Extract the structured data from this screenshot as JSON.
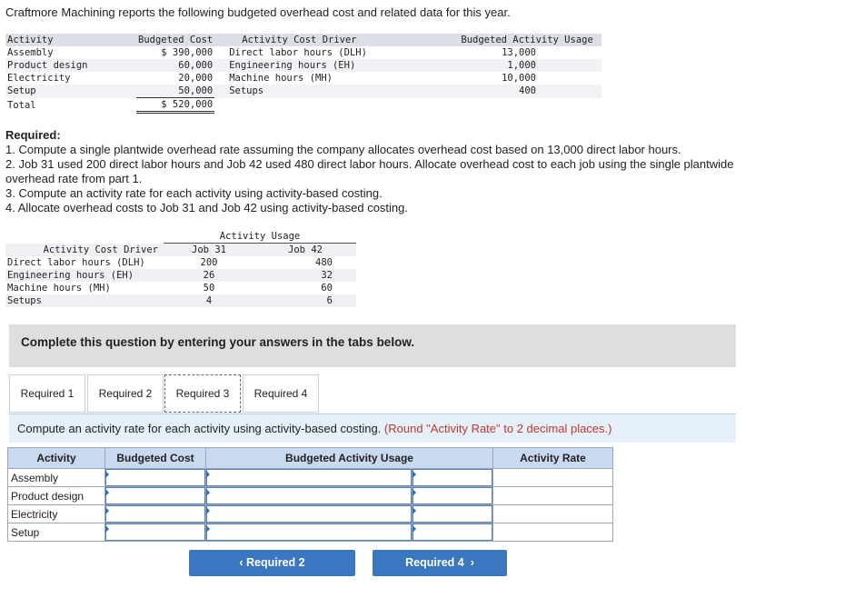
{
  "intro": "Craftmore Machining reports the following budgeted overhead cost and related data for this year.",
  "budget_table": {
    "headers": [
      "Activity",
      "Budgeted Cost",
      "Activity Cost Driver",
      "Budgeted Activity Usage"
    ],
    "rows": [
      {
        "activity": "Assembly",
        "cost": "$ 390,000",
        "driver": "Direct labor hours (DLH)",
        "usage": "13,000"
      },
      {
        "activity": "Product design",
        "cost": "60,000",
        "driver": "Engineering hours (EH)",
        "usage": "1,000"
      },
      {
        "activity": "Electricity",
        "cost": "20,000",
        "driver": "Machine hours (MH)",
        "usage": "10,000"
      },
      {
        "activity": "Setup",
        "cost": "50,000",
        "driver": "Setups",
        "usage": "400"
      }
    ],
    "total_label": "Total",
    "total_cost": "$ 520,000"
  },
  "required": {
    "title": "Required:",
    "items": [
      "1. Compute a single plantwide overhead rate assuming the company allocates overhead cost based on 13,000 direct labor hours.",
      "2. Job 31 used 200 direct labor hours and Job 42 used 480 direct labor hours. Allocate overhead cost to each job using the single plantwide overhead rate from part 1.",
      "3. Compute an activity rate for each activity using activity-based costing.",
      "4. Allocate overhead costs to Job 31 and Job 42 using activity-based costing."
    ]
  },
  "usage_table": {
    "group_header": "Activity Usage",
    "driver_header": "Activity Cost Driver",
    "job_headers": [
      "Job 31",
      "Job 42"
    ],
    "rows": [
      {
        "driver": "Direct labor hours (DLH)",
        "job31": "200",
        "job42": "480"
      },
      {
        "driver": "Engineering hours (EH)",
        "job31": "26",
        "job42": "32"
      },
      {
        "driver": "Machine hours (MH)",
        "job31": "50",
        "job42": "60"
      },
      {
        "driver": "Setups",
        "job31": "4",
        "job42": "6"
      }
    ]
  },
  "banner": "Complete this question by entering your answers in the tabs below.",
  "tabs": [
    "Required 1",
    "Required 2",
    "Required 3",
    "Required 4"
  ],
  "active_tab": "Required 3",
  "instruction": "Compute an activity rate for each activity using activity-based costing.",
  "instruction_note": "(Round \"Activity Rate\" to 2 decimal places.)",
  "answer_grid": {
    "headers": [
      "Activity",
      "Budgeted Cost",
      "Budgeted Activity Usage",
      "Activity Rate"
    ],
    "rows": [
      "Assembly",
      "Product design",
      "Electricity",
      "Setup"
    ]
  },
  "nav": {
    "prev": "Required 2",
    "next": "Required 4"
  }
}
